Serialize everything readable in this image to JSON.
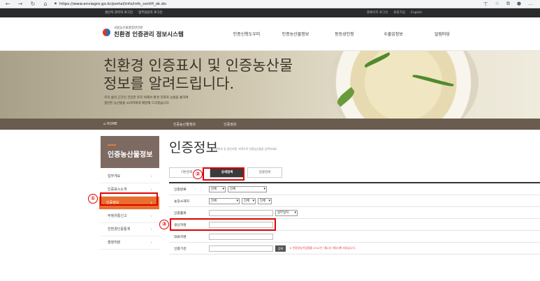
{
  "browser": {
    "url": "https://www.enviagro.go.kr/portal/info/info_certifi_ok.do"
  },
  "utility": {
    "left": [
      "생산자 관리자 로그인",
      "업무담당자 로그인"
    ],
    "right": [
      "홈페이지 로그인",
      "회원가입",
      "English"
    ]
  },
  "header": {
    "org": "국립농산물품질관리원",
    "title": "친환경 인증관리 정보시스템",
    "menu": [
      "인증신청도우미",
      "인증농산물정보",
      "동등성인정",
      "수출입정보",
      "알림마당"
    ]
  },
  "hero": {
    "line1": "친환경 인증표시 및 인증농산물",
    "line2": "정보를 알려드립니다.",
    "desc1": "우리 삶의 근간인 건강한 토지 위해서 환경 친화적 농법을 통하여",
    "desc2": "생산된 농산물을 소비자에게 배달해 드리겠습니다."
  },
  "breadcrumb": [
    "HOME",
    "인증농산물정보",
    "인증정보"
  ],
  "side": {
    "title": "인증농산물정보",
    "items": [
      "업무개요",
      "인증표시소개",
      "인증정보",
      "부정유통신고",
      "친환경인증통계",
      "행정처분"
    ]
  },
  "page": {
    "title": "인증정보",
    "subtitle": "인증번호 및 생산자명, 지역으로 인증농산물을 검색하세요."
  },
  "tabs": [
    "기본검색",
    "상세검색",
    "일괄검색"
  ],
  "form": {
    "labels": [
      "인증분류",
      "농장소재지",
      "인증품목",
      "생산자명",
      "대표자명",
      "인증기관"
    ],
    "cat_selects": [
      "전체",
      "전체"
    ],
    "loc_selects": [
      "전체",
      "전체",
      "전체"
    ],
    "item_select": "일부일치",
    "search_btn": "검색",
    "note": "※ 친환경농어업법률 2014년 7월1일 개정시행 되었습니다."
  },
  "annotations": [
    "①",
    "②",
    "③"
  ]
}
